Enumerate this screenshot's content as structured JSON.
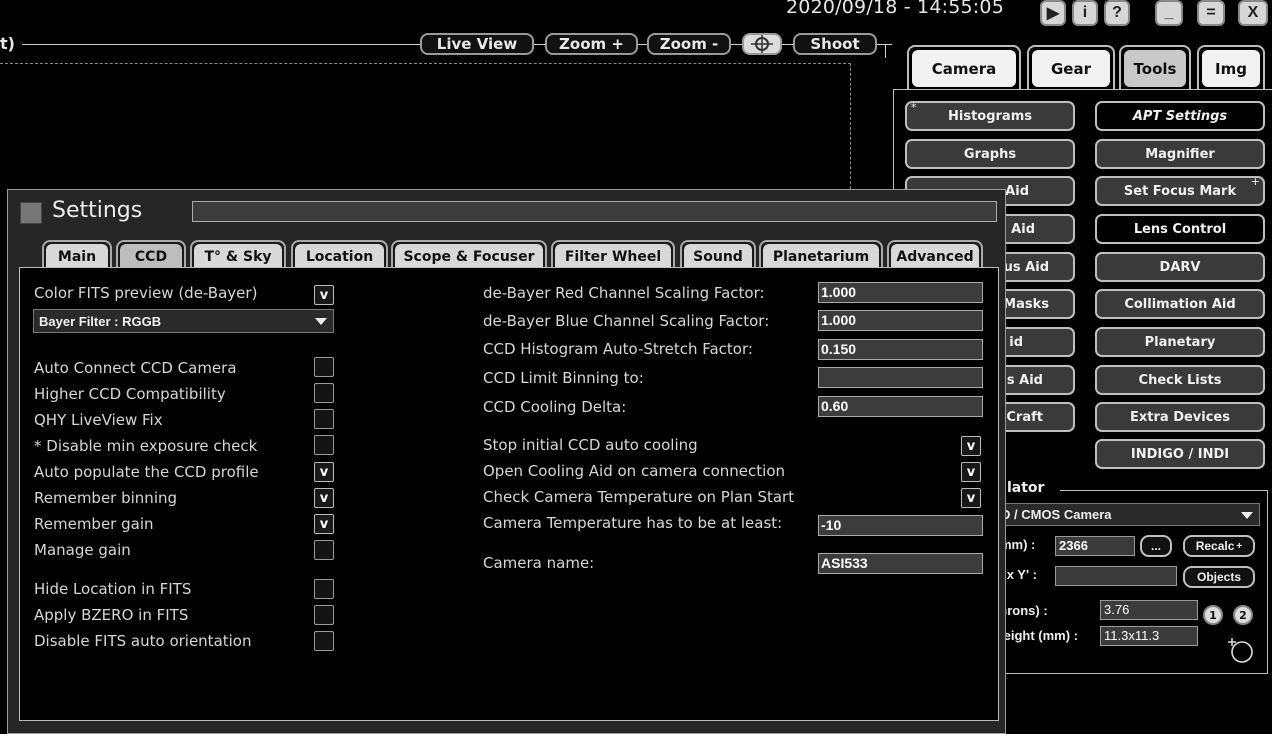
{
  "topbar": {
    "datetime": "2020/09/18 - 14:55:05",
    "window_buttons": [
      "▶",
      "i",
      "?",
      "_",
      "=",
      "X"
    ]
  },
  "live_view_toolbar": {
    "title_fragment": "t)",
    "buttons": [
      "Live View",
      "Zoom +",
      "Zoom -",
      "",
      "Shoot"
    ]
  },
  "right_panel": {
    "tabs": [
      "Camera",
      "Gear",
      "Tools",
      "Img"
    ],
    "active_tab": "Tools",
    "tools_left": [
      "Histograms",
      "Graphs",
      "Aid",
      "Aid",
      "us Aid",
      "Masks",
      "id",
      "s Aid",
      "Craft"
    ],
    "tools_right": [
      "APT Settings",
      "Magnifier",
      "Set Focus Mark",
      "Lens Control",
      "DARV",
      "Collimation Aid",
      "Planetary",
      "Check Lists",
      "Extra Devices",
      "INDIGO / INDI"
    ],
    "calculator": {
      "title": "ulator",
      "camera_select": "D / CMOS Camera",
      "focal_label": "mm) :",
      "focal_value": "2366",
      "more_btn": "...",
      "recalc_btn": "Recalc",
      "xy_label": "' x Y' :",
      "objects_btn": "Objects",
      "pixel_label": "crons) :",
      "pixel_value": "3.76",
      "size_label": "leight (mm) :",
      "size_value": "11.3x11.3",
      "btn1": "1",
      "btn2": "2"
    }
  },
  "dialog": {
    "title": "Settings",
    "tabs": [
      "Main",
      "CCD",
      "T° & Sky",
      "Location",
      "Scope & Focuser",
      "Filter Wheel",
      "Sound",
      "Planetarium",
      "Advanced"
    ],
    "active_tab": "CCD",
    "left": {
      "color_fits_label": "Color FITS preview (de-Bayer)",
      "color_fits_checked": "v",
      "bayer_select": "Bayer Filter : RGGB",
      "options": [
        {
          "label": "Auto Connect CCD Camera",
          "mark": ""
        },
        {
          "label": "Higher CCD Compatibility",
          "mark": ""
        },
        {
          "label": "QHY LiveView Fix",
          "mark": ""
        },
        {
          "label": "* Disable min exposure check",
          "mark": ""
        },
        {
          "label": "Auto populate the CCD profile",
          "mark": "v"
        },
        {
          "label": "Remember binning",
          "mark": "v"
        },
        {
          "label": "Remember gain",
          "mark": "v"
        },
        {
          "label": "Manage gain",
          "mark": ""
        }
      ],
      "options2": [
        {
          "label": "Hide Location in FITS",
          "mark": ""
        },
        {
          "label": "Apply BZERO in FITS",
          "mark": ""
        },
        {
          "label": "Disable FITS auto orientation",
          "mark": ""
        }
      ]
    },
    "right": {
      "fields": [
        {
          "label": "de-Bayer Red Channel Scaling Factor:",
          "value": "1.000"
        },
        {
          "label": "de-Bayer Blue Channel Scaling Factor:",
          "value": "1.000"
        },
        {
          "label": "CCD Histogram Auto-Stretch Factor:",
          "value": "0.150"
        },
        {
          "label": "CCD Limit Binning to:",
          "value": ""
        },
        {
          "label": "CCD Cooling Delta:",
          "value": "0.60"
        }
      ],
      "cooling_options": [
        {
          "label": "Stop initial CCD auto cooling",
          "mark": "v"
        },
        {
          "label": "Open Cooling Aid on camera connection",
          "mark": "v"
        },
        {
          "label": "Check Camera Temperature on Plan Start",
          "mark": "v"
        }
      ],
      "min_temp_label": "Camera Temperature has to be at least:",
      "min_temp_value": "-10",
      "camera_name_label": "Camera name:",
      "camera_name_value": "ASI533"
    }
  }
}
